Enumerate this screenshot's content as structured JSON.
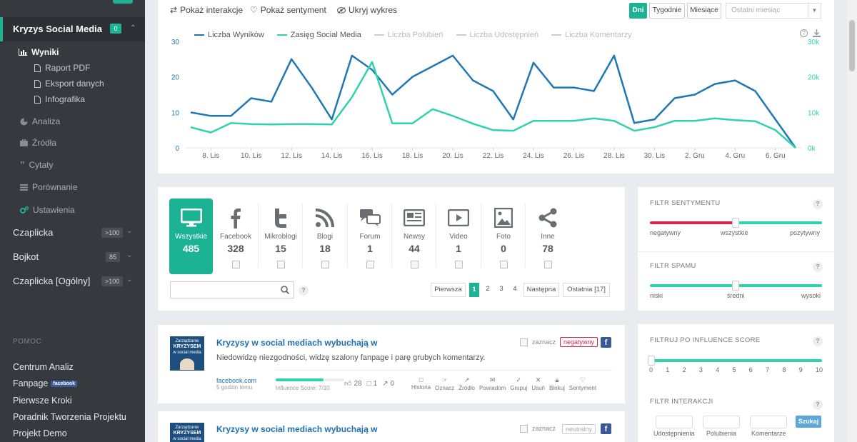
{
  "sidebar": {
    "active_project": {
      "label": "Kryzys Social Media",
      "badge": "0"
    },
    "sub_items": [
      {
        "label": "Wyniki",
        "icon": "bar-chart-icon"
      },
      {
        "label": "Raport PDF",
        "icon": "document-icon"
      },
      {
        "label": "Eksport danych",
        "icon": "document-icon"
      },
      {
        "label": "Infografika",
        "icon": "document-icon"
      }
    ],
    "nav_items": [
      {
        "label": "Analiza",
        "icon": "pie-chart-icon"
      },
      {
        "label": "Źródła",
        "icon": "briefcase-icon"
      },
      {
        "label": "Cytaty",
        "icon": "quote-icon"
      },
      {
        "label": "Porównanie",
        "icon": "list-icon"
      },
      {
        "label": "Ustawienia",
        "icon": "cogs-icon"
      }
    ],
    "projects": [
      {
        "label": "Czaplicka",
        "badge": ">100"
      },
      {
        "label": "Bojkot",
        "badge": "85"
      },
      {
        "label": "Czaplicka [Ogólny]",
        "badge": ">100"
      }
    ],
    "help_title": "POMOC",
    "help_links": [
      "Centrum Analiz",
      "Fanpage",
      "Pierwsze Kroki",
      "Poradnik Tworzenia Projektu",
      "Projekt Demo"
    ],
    "fanpage_badge": "facebook"
  },
  "toolbar": {
    "show_interactions": "Pokaż interakcje",
    "show_sentiment": "Pokaż sentyment",
    "hide_chart": "Ukryj wykres",
    "periods": [
      "Dni",
      "Tygodnie",
      "Miesiące"
    ],
    "active_period": "Dni",
    "range_value": "Ostatni miesiąc"
  },
  "chart_data": {
    "type": "line",
    "x": [
      "7. Lis",
      "8. Lis",
      "9. Lis",
      "10. Lis",
      "11. Lis",
      "12. Lis",
      "13. Lis",
      "14. Lis",
      "15. Lis",
      "16. Lis",
      "17. Lis",
      "18. Lis",
      "19. Lis",
      "20. Lis",
      "21. Lis",
      "22. Lis",
      "23. Lis",
      "24. Lis",
      "25. Lis",
      "26. Lis",
      "27. Lis",
      "28. Lis",
      "29. Lis",
      "30. Lis",
      "1. Gru",
      "2. Gru",
      "3. Gru",
      "4. Gru",
      "5. Gru",
      "6. Gru",
      "7. Gru"
    ],
    "x_ticks": [
      "8. Lis",
      "10. Lis",
      "12. Lis",
      "14. Lis",
      "16. Lis",
      "18. Lis",
      "20. Lis",
      "22. Lis",
      "24. Lis",
      "26. Lis",
      "28. Lis",
      "30. Lis",
      "2. Gru",
      "4. Gru",
      "6. Gru"
    ],
    "series": [
      {
        "name": "Liczba Wyników",
        "color": "#1f77b4",
        "axis": "left",
        "active": true,
        "values": [
          10,
          9,
          9,
          14,
          13,
          25,
          17,
          8,
          26,
          22,
          15,
          20,
          23,
          26,
          19,
          16,
          8,
          24,
          17,
          17,
          16,
          26,
          7,
          8,
          14,
          15,
          18,
          19,
          16,
          8,
          0
        ]
      },
      {
        "name": "Zasięg Social Media",
        "color": "#2ed3ab",
        "axis": "right",
        "active": true,
        "values": [
          5800,
          4300,
          7000,
          6700,
          6600,
          6700,
          6700,
          6600,
          14300,
          24200,
          6900,
          6900,
          10900,
          9000,
          6800,
          5000,
          4800,
          7600,
          7600,
          7600,
          8300,
          7600,
          4800,
          5800,
          7600,
          7600,
          8300,
          7800,
          7500,
          5000,
          0
        ]
      },
      {
        "name": "Liczba Polubień",
        "color": "#cccccc",
        "axis": "left",
        "active": false,
        "values": []
      },
      {
        "name": "Liczba Udostępnień",
        "color": "#cccccc",
        "axis": "left",
        "active": false,
        "values": []
      },
      {
        "name": "Liczba Komentarzy",
        "color": "#cccccc",
        "axis": "left",
        "active": false,
        "values": []
      }
    ],
    "ylim_left": [
      0,
      30
    ],
    "yticks_left": [
      "0",
      "10",
      "20",
      "30"
    ],
    "ylim_right": [
      0,
      30000
    ],
    "yticks_right": [
      "0k",
      "10k",
      "20k",
      "30k"
    ],
    "legend_position": "top",
    "grid": false
  },
  "sources": {
    "categories": [
      {
        "label": "Wszystkie",
        "count": "485",
        "icon": "monitor-icon",
        "active": true
      },
      {
        "label": "Facebook",
        "count": "328",
        "icon": "facebook-icon"
      },
      {
        "label": "Mikroblogi",
        "count": "15",
        "icon": "twitter-icon"
      },
      {
        "label": "Blogi",
        "count": "18",
        "icon": "rss-icon"
      },
      {
        "label": "Forum",
        "count": "1",
        "icon": "comments-icon"
      },
      {
        "label": "Newsy",
        "count": "44",
        "icon": "newspaper-icon"
      },
      {
        "label": "Video",
        "count": "1",
        "icon": "play-icon"
      },
      {
        "label": "Foto",
        "count": "0",
        "icon": "picture-icon"
      },
      {
        "label": "Inne",
        "count": "78",
        "icon": "share-icon"
      }
    ],
    "search_placeholder": "",
    "pagination": {
      "first": "Pierwsza",
      "pages": [
        "1",
        "2",
        "3",
        "4"
      ],
      "active": "1",
      "next": "Następna",
      "last": "Ostatnia [17]"
    }
  },
  "filters": {
    "sentiment": {
      "title": "FILTR SENTYMENTU",
      "labels": [
        "negatywny",
        "wszystkie",
        "pozytywny"
      ],
      "position_fraction": 0.5
    },
    "spam": {
      "title": "FILTR SPAMU",
      "labels": [
        "niski",
        "średni",
        "wysoki"
      ],
      "position_fraction": 0.5
    },
    "influence": {
      "title": "FILTRUJ PO INFLUENCE SCORE",
      "ticks": [
        "0",
        "1",
        "2",
        "3",
        "4",
        "5",
        "6",
        "7",
        "8",
        "9",
        "10"
      ],
      "value": 0
    },
    "interaction": {
      "title": "FILTR INTERAKCJI",
      "fields": [
        "Udostępnienia",
        "Polubienia",
        "Komentarze"
      ],
      "button": "Szukaj"
    },
    "help": "?"
  },
  "posts": [
    {
      "title": "Kryzysy w social mediach wybuchają w",
      "body": "Niedowidzę niezgodności, widzę szalony fanpage i parę grubych komentarzy.",
      "source": "facebook.com",
      "time": "5 godzin temu",
      "influence_label": "Influence Score: 7/10",
      "influence_fraction": 0.7,
      "likes": "28",
      "comments": "1",
      "shares": "0",
      "mark_label": "zaznacz",
      "sentiment": "negatywny",
      "thumb_text": [
        "Zarządzanie",
        "KRYZYSEM",
        "w social media"
      ],
      "actions": [
        "Historia",
        "Oznacz",
        "Źródło",
        "Powiadom",
        "Grupuj",
        "Usuń",
        "Blokuj",
        "Sentyment"
      ]
    },
    {
      "title": "Kryzysy w social mediach wybuchają w",
      "mark_label": "zaznacz",
      "sentiment": "neutralny",
      "thumb_text": [
        "Zarządzanie",
        "KRYZYSEM",
        "w social media"
      ]
    }
  ]
}
